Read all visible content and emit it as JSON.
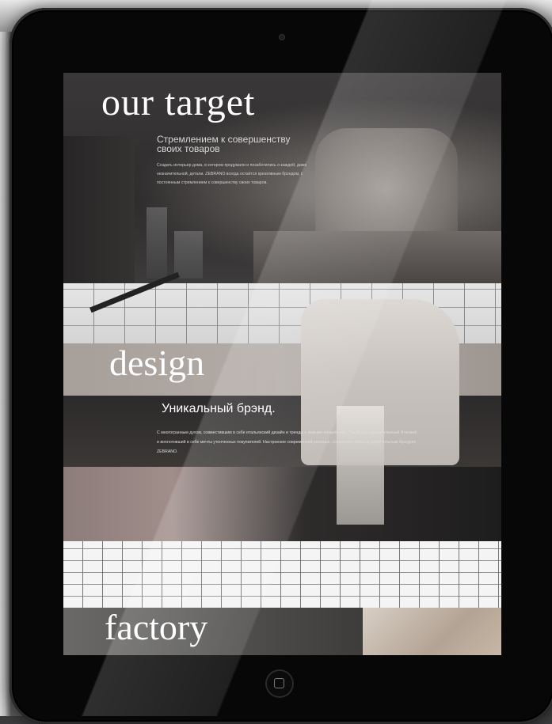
{
  "target": {
    "heading": "our target",
    "subheading": "Стремлением к совершенству своих товаров",
    "body": "Создать интерьер дома, в котором продумали и позаботились о каждой, даже незначительной, детали. ZEBRANO всегда остаётся креативным брэндом, с постоянным стремлением к совершенству своих товаров."
  },
  "design": {
    "heading": "design",
    "subheading": "Уникальный брэнд.",
    "body": "С многогранным духом, совместившим в себе итальянский дизайн и тренды с новыми концептами. Такой дух, вдохновленный Италией, и воплотивший в себе мечты утонченных покупателей. Настроение современной роскоши, созданное новым и удивительным брэндом ZEBRANO."
  },
  "factory": {
    "heading": "factory"
  },
  "device": {
    "camera_icon": "camera-icon",
    "home_icon": "home-button-icon"
  },
  "colors": {
    "bezel": "#070707",
    "heading_text": "#ffffff"
  }
}
